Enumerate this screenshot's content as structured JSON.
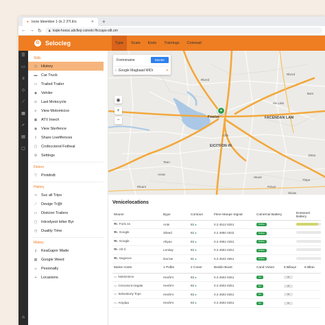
{
  "browser": {
    "tab_title": "Isore Ideember 1-1k 2 3?I.tIrs",
    "url": "Ioqle-hoosc.aticfiep coinelo fhccaps-stlt.om"
  },
  "app": {
    "logo_letter": "G",
    "title": "Selocleg"
  },
  "topnav": [
    "Type",
    "Scats",
    "Ends",
    "Trainings",
    "Coismail"
  ],
  "sidebar": {
    "sections": [
      {
        "heading": "Sklls",
        "items": [
          {
            "label": "History",
            "active": true,
            "icon": "clock-icon"
          },
          {
            "label": "Car Truck",
            "icon": "truck-icon"
          },
          {
            "label": "Trailed Trailer",
            "icon": "trailer-icon"
          },
          {
            "label": "Vehiler",
            "icon": "vehicle-icon"
          },
          {
            "label": "Last Motocycle",
            "icon": "motorcycle-icon"
          },
          {
            "label": "View Motomicice",
            "icon": "list-icon"
          },
          {
            "label": "ATV Iniech",
            "icon": "atv-icon"
          },
          {
            "label": "View Sterfence",
            "icon": "eye-icon"
          },
          {
            "label": "Share Livefifences",
            "icon": "share-icon"
          },
          {
            "label": "Crofecctend Fotheal",
            "icon": "doc-icon"
          },
          {
            "label": "Settings",
            "icon": "gear-icon"
          }
        ]
      },
      {
        "heading": "Flelers",
        "items": [
          {
            "label": "Protdndt",
            "icon": "filter-icon"
          }
        ]
      },
      {
        "heading": "History",
        "items": [
          {
            "label": "Suc all Trips",
            "icon": "trip-icon"
          },
          {
            "label": "Desige Tr@t",
            "icon": "route-icon"
          },
          {
            "label": "Distcion Trailers",
            "icon": "trailer-icon"
          },
          {
            "label": "Introdyest Ielter Byr",
            "icon": "doc-icon"
          },
          {
            "label": "Duality Time",
            "icon": "clock-icon"
          }
        ]
      },
      {
        "heading": "Makey",
        "items": [
          {
            "label": "KeaGapor Made",
            "icon": "key-icon"
          },
          {
            "label": "Google Weed",
            "icon": "map-icon"
          },
          {
            "label": "Pesionally",
            "icon": "user-icon"
          },
          {
            "label": "Locasions",
            "icon": "pin-icon"
          }
        ]
      }
    ]
  },
  "map": {
    "panel": {
      "label": "Fomnmame",
      "button": "Munter",
      "search": "Google Magbaad MIDt"
    },
    "labels": {
      "center": "Fewlot",
      "east": "FACENDAN LAM",
      "center_south": "EICITFON IN",
      "cfts": "Cfts",
      "r1": "Rlvrrd",
      "r2": "Rlvrrd",
      "a1": "Areat",
      "a2": "Aiv Lats",
      "r3": "Rlearn",
      "t1": "Tann",
      "t2": "Tlnpe",
      "s1": "Hkuer",
      "s2": "Pclver",
      "s3": "Slcaw",
      "s4": "Bars",
      "s5": "Mrsa"
    }
  },
  "vehicle_locations": {
    "title": "Venicelocations",
    "columns": [
      "Moune",
      "Byye",
      "Contoun",
      "Flere Manpe Signal",
      "Colnernal Battery",
      "Emtsenel Battery"
    ],
    "rows": [
      {
        "icon": "car-icon",
        "name": "Forlc.ss",
        "type": "Ants",
        "count": "83",
        "signal": "0.3 4512 6251",
        "status": "Online",
        "fill": 0.8
      },
      {
        "icon": "car-icon",
        "name": "Google",
        "type": "Sileed",
        "count": "82",
        "signal": "0.2 4850 4532",
        "status": "Online",
        "fill": 0.0
      },
      {
        "icon": "car-icon",
        "name": "Google",
        "type": "Altyao",
        "count": "83",
        "signal": "0.3 4952 4281",
        "status": "Online",
        "fill": 0.0
      },
      {
        "icon": "car-icon",
        "name": "Afr.rl.",
        "type": "Lentiay",
        "count": "83",
        "signal": "0.3 4552 6251",
        "status": "Online",
        "fill": 0.0
      },
      {
        "icon": "car-icon",
        "name": "Segence",
        "type": "Dai las",
        "count": "81",
        "signal": "0.3 4542 4551",
        "status": "Online",
        "fill": 0.0
      }
    ]
  },
  "trailers": {
    "columns": [
      "Maine noots",
      "1 Pulbs",
      "2 Cover",
      "Beddo Boart",
      "Cand Votion",
      "5 Biliaçe",
      "6 Bllan"
    ],
    "rows": [
      {
        "icon": "trailer-icon",
        "name": "Notminince",
        "a": "Heofe's",
        "b": "83",
        "c": "0.3 4502 6251",
        "d": "On",
        "e": "Ot"
      },
      {
        "icon": "trailer-icon",
        "name": "Crecoscnt Iregate",
        "a": "Heofe's",
        "b": "83",
        "c": "0.3 4502 6251",
        "d": "On",
        "e": "Ot"
      },
      {
        "icon": "trailer-icon",
        "name": "Selvestoriy Tcpn",
        "a": "Heofe's",
        "b": "83",
        "c": "0.3 4502 6251",
        "d": "On",
        "e": "Ot"
      },
      {
        "icon": "trailer-icon",
        "name": "Amplaa",
        "a": "Heofe's",
        "b": "83",
        "c": "0.3 4502 6251",
        "d": "On",
        "e": "Ot"
      }
    ]
  },
  "colors": {
    "brand": "#ef7d22",
    "active_bg": "#f6b57c",
    "status_green": "#2e9d4e",
    "bar_yellow": "#cfd56a"
  }
}
